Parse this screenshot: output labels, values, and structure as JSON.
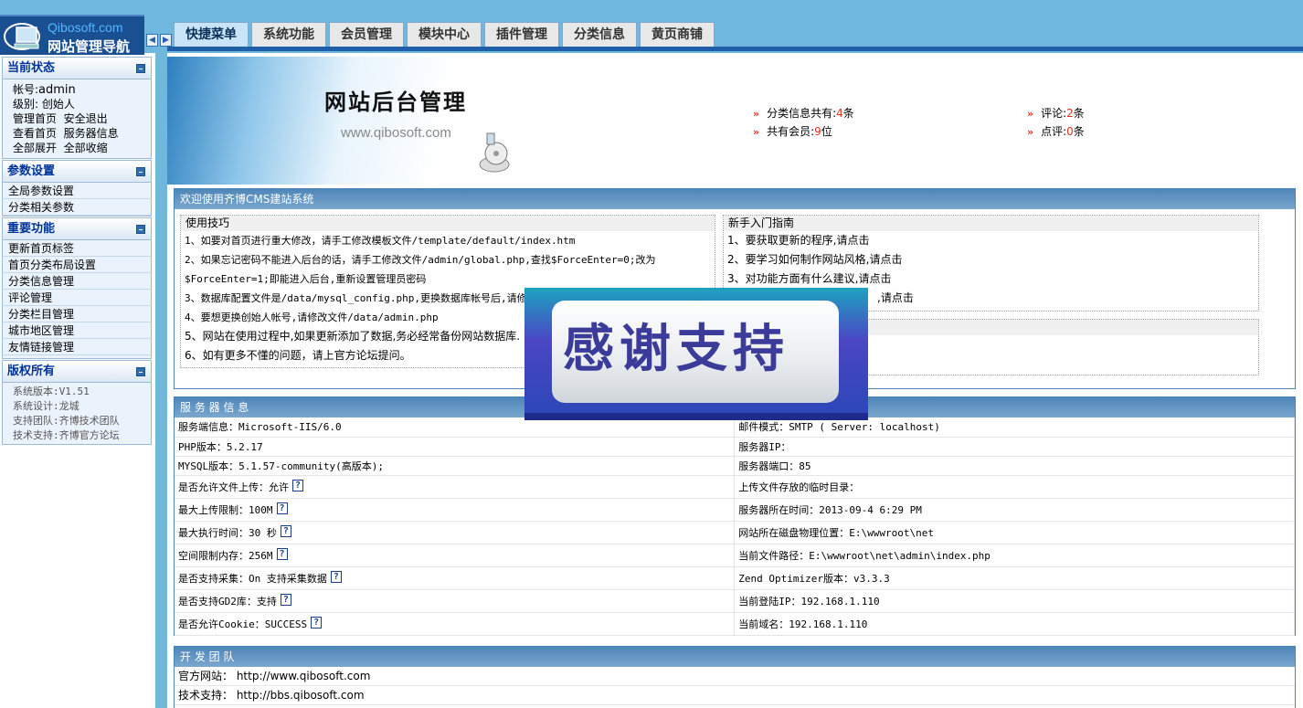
{
  "header": {
    "logo_top": "Qibosoft.com",
    "logo_bottom": "网站管理导航",
    "tabs": [
      {
        "label": "快捷菜单",
        "active": true
      },
      {
        "label": "系统功能"
      },
      {
        "label": "会员管理"
      },
      {
        "label": "模块中心"
      },
      {
        "label": "插件管理"
      },
      {
        "label": "分类信息"
      },
      {
        "label": "黄页商铺"
      }
    ]
  },
  "sidebar": {
    "status": {
      "title": "当前状态",
      "account_label": "帐号:",
      "account": "admin",
      "level": "级别: 创始人",
      "links_row1": [
        "管理首页",
        "安全退出"
      ],
      "links_row2": [
        "查看首页",
        "服务器信息"
      ],
      "links_row3": [
        "全部展开",
        "全部收缩"
      ]
    },
    "params": {
      "title": "参数设置",
      "items": [
        "全局参数设置",
        "分类相关参数"
      ]
    },
    "important": {
      "title": "重要功能",
      "items": [
        "更新首页标签",
        "首页分类布局设置",
        "分类信息管理",
        "评论管理",
        "分类栏目管理",
        "城市地区管理",
        "友情链接管理"
      ]
    },
    "copyright": {
      "title": "版权所有",
      "lines": [
        "系统版本:V1.51",
        "系统设计:龙城",
        "支持团队:齐博技术团队",
        "技术支持:齐博官方论坛"
      ]
    }
  },
  "banner": {
    "title": "网站后台管理",
    "url": "www.qibosoft.com"
  },
  "stats": {
    "classified_label": "分类信息共有:",
    "classified": "4",
    "classified_unit": "条",
    "members_label": "共有会员:",
    "members": "9",
    "members_unit": "位",
    "comments_label": "评论:",
    "comments": "2",
    "comments_unit": "条",
    "ratings_label": "点评:",
    "ratings": "0",
    "ratings_unit": "条"
  },
  "welcome": {
    "title": "欢迎使用齐博CMS建站系统",
    "tips_title": "使用技巧",
    "tips": [
      "1、如要对首页进行重大修改，请手工修改模板文件/template/default/index.htm",
      "2、如果忘记密码不能进入后台的话，请手工修改文件/admin/global.php,查找$ForceEnter=0;改为",
      "$ForceEnter=1;即能进入后台,重新设置管理员密码",
      "3、数据库配置文件是/data/mysql_config.php,更换数据库帐号后,请修",
      "4、要想更换创始人帐号,请修改文件/data/admin.php",
      "5、网站在使用过程中,如果更新添加了数据,务必经常备份网站数据库.",
      "6、如有更多不懂的问题，请上官方论坛提问。"
    ],
    "guide_title": "新手入门指南",
    "guide": [
      "1、要获取更新的程序,请点击",
      "2、要学习如何制作网站风格,请点击",
      "3、对功能方面有什么建议,请点击",
      ",请点击"
    ]
  },
  "server": {
    "title": "服 务 器 信 息",
    "rows": [
      [
        "服务端信息：Microsoft-IIS/6.0",
        "邮件模式：SMTP ( Server: localhost)"
      ],
      [
        "PHP版本：5.2.17",
        "服务器IP："
      ],
      [
        "MYSQL版本：5.1.57-community(高版本);",
        "服务器端口：85"
      ],
      [
        "是否允许文件上传：允许",
        "上传文件存放的临时目录："
      ],
      [
        "最大上传限制：100M",
        "服务器所在时间：2013-09-4 6:29 PM"
      ],
      [
        "最大执行时间：30 秒",
        "网站所在磁盘物理位置：E:\\wwwroot\\net"
      ],
      [
        "空间限制内存：256M",
        "当前文件路径：E:\\wwwroot\\net\\admin\\index.php"
      ],
      [
        "是否支持采集：On 支持采集数据",
        "Zend Optimizer版本：v3.3.3"
      ],
      [
        "是否支持GD2库：支持",
        "当前登陆IP：192.168.1.110"
      ],
      [
        "是否允许Cookie：SUCCESS",
        "当前域名：192.168.1.110"
      ]
    ],
    "help_mark": "?"
  },
  "team": {
    "title": "开 发 团 队",
    "rows": [
      "官方网站：  http://www.qibosoft.com",
      "技术支持：  http://bbs.qibosoft.com"
    ]
  },
  "overlay": {
    "text": "感谢支持"
  },
  "colors": {
    "accent": "#1f5fa8",
    "header_bg": "#6fb7dd",
    "highlight": "#e0301e"
  }
}
